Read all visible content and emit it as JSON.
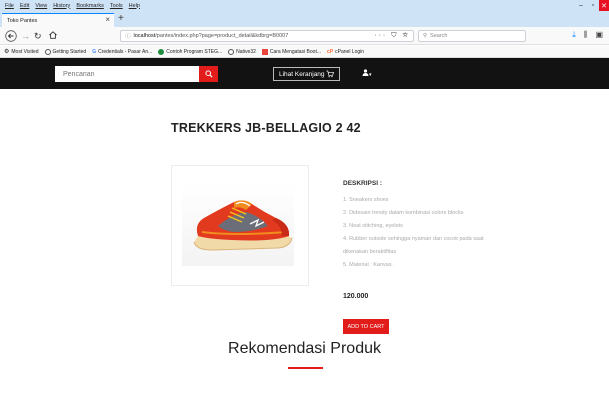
{
  "browser": {
    "menu": [
      "File",
      "Edit",
      "View",
      "History",
      "Bookmarks",
      "Tools",
      "Help"
    ],
    "tab_title": "Toko Pantes",
    "url_host": "localhost",
    "url_path": "/pantes/index.php?page=product_detail&kdbrg=B0007",
    "search_placeholder": "Search",
    "bookmarks": [
      {
        "label": "Most Visited",
        "color": "#555555"
      },
      {
        "label": "Getting Started",
        "color": "#555555"
      },
      {
        "label": "Credentials - Pasar An...",
        "color": "#4285f4"
      },
      {
        "label": "Contoh Program STEG...",
        "color": "#1e8e3e"
      },
      {
        "label": "Native32",
        "color": "#555555"
      },
      {
        "label": "Cara Mengatasi Boot...",
        "color": "#e8453c"
      },
      {
        "label": "cPanel Login",
        "color": "#ff6c2c"
      }
    ]
  },
  "site": {
    "search_placeholder": "Pencarian",
    "cart_label": "Lihat Keranjang",
    "user_caret": "▾"
  },
  "product": {
    "title": "TREKKERS JB-BELLAGIO 2 42",
    "desc_heading": "DESKRIPSI :",
    "desc_lines": [
      "1. Sneakers shoes",
      "2. Didesain trendy dalam kombinasi colors blocks",
      "3. Neat stitching, eyelets",
      "4. Rubber outsole sehingga nyaman dan cocok pada saat",
      "dikenakan beraktifitas",
      "5. Material : Kanvas ."
    ],
    "price": "120.000",
    "add_to_cart_label": "ADD TO CART"
  },
  "recommendation": {
    "title": "Rekomendasi Produk"
  },
  "colors": {
    "accent": "#e21b1b",
    "header_bg": "#121212"
  }
}
